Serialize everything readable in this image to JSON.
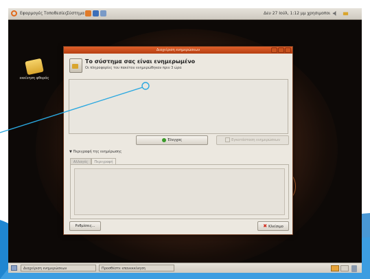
{
  "top_panel": {
    "menu": [
      "Εφαρμογές",
      "Τοποθεσίες",
      "Σύστημα"
    ],
    "clock": "Δευ 27 Ιούλ, 1:12 μμ χρησιμοποι"
  },
  "desktop": {
    "icon_label": "εκκίνηση φθοράς"
  },
  "dialog": {
    "title": "Διαχείριση ενημερώσεων",
    "headline": "Το σύστημα σας είναι ενημερωμένο",
    "subline": "Οι πληροφορίες του πακέτου ενημερώθηκαν πριν 3 ώρα",
    "check_label": "Έλεγχος",
    "install_label": "Εγκατάσταση ενημερώσεων",
    "details_expander": "Περιγραφή της ενημέρωσης",
    "tabs": [
      "Αλλαγές",
      "Περιγραφή"
    ],
    "settings_label": "Ρυθμίσεις...",
    "close_label": "Κλείσιμο"
  },
  "bottom_panel": {
    "tasks": [
      "Διαχείριση ενημερώσεων",
      "Προσθέστε επανεκκίνηση"
    ]
  },
  "colors": {
    "title_orange": "#c94a1c",
    "callout_blue": "#2aa8e0",
    "check_green": "#3a9a2a",
    "close_red": "#d0281a"
  }
}
